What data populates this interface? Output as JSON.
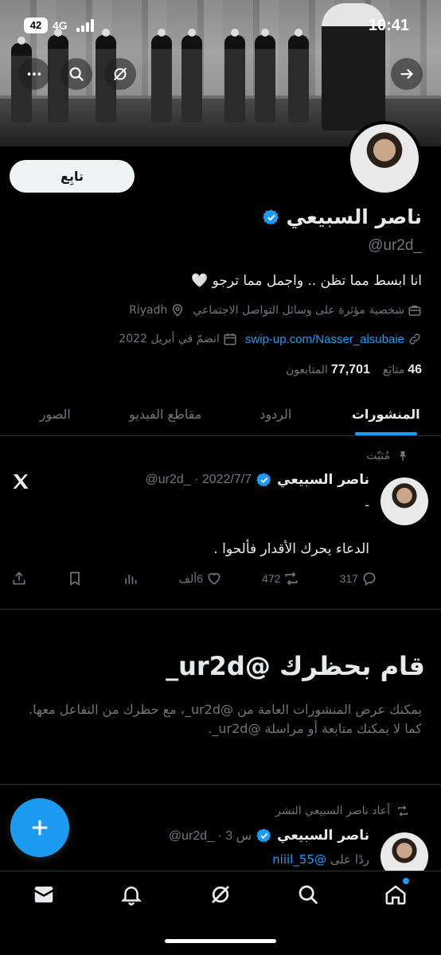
{
  "status_bar": {
    "battery": "42",
    "network": "4G",
    "time": "10:41"
  },
  "header": {
    "more_icon": "more-dots-icon",
    "search_icon": "search-icon",
    "grok_icon": "grok-icon",
    "back_icon": "arrow-right-icon"
  },
  "profile": {
    "follow_label": "تابِع",
    "name": "ناصر السبيعي",
    "handle": "@ur2d_",
    "bio": "انا ابسط مما تظن .. واجمل مما ترجو 🤍",
    "category": "شخصية مؤثرة على وسائل التواصل الاجتماعي",
    "location": "Riyadh",
    "link": "swip-up.com/Nasser_alsubaie",
    "joined": "انضمّ في أبريل 2022",
    "following_count": "46",
    "following_label": "متابَع",
    "followers_count": "77,701",
    "followers_label": "المتابعون"
  },
  "tabs": [
    {
      "label": "المنشورات",
      "active": true
    },
    {
      "label": "الردود",
      "active": false
    },
    {
      "label": "مقاطع الفيديو",
      "active": false
    },
    {
      "label": "الصور",
      "active": false
    }
  ],
  "pinned_post": {
    "pinned_label": "مُثبّت",
    "author": "ناصر السبيعي",
    "meta": "@ur2d_ · 2022/7/7",
    "dash": "-",
    "text": "الدعاء يحرك الأقدار فألحوا .",
    "replies": "317",
    "reposts": "472",
    "likes": "6ألف"
  },
  "blocked": {
    "title": "قام بحظرك @ur2d_",
    "description": "يمكنك عرض المنشورات العامة من @ur2d_، مع حظرك من التفاعل معها. كما لا يمكنك متابعة أو مراسلة @ur2d_."
  },
  "repost": {
    "label": "أعاد ناصر السبيعي النشر",
    "author": "ناصر السبيعي",
    "meta": "@ur2d_ · 3 س",
    "reply_prefix": "ردًا على",
    "reply_to": "@niiil_55"
  },
  "colors": {
    "accent": "#1d9bf0",
    "background": "#000000",
    "muted": "#71767b",
    "text": "#e7e9ea"
  }
}
